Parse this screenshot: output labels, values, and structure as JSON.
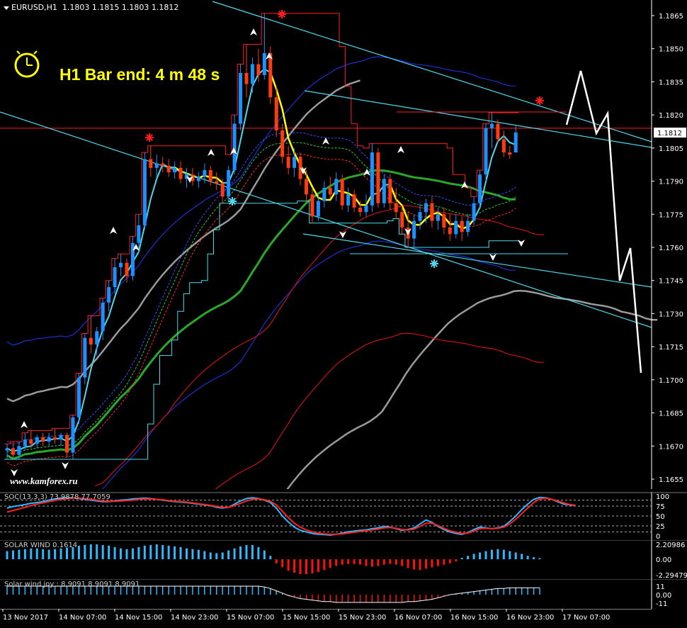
{
  "header": {
    "symbol": "EURUSD,H1",
    "ohlc": "1.1803 1.1815 1.1803 1.1812"
  },
  "bar_end_label": "H1 Bar end: 4 m 48 s",
  "watermark": "www.kamforex.ru",
  "current_price_label": "1.1812",
  "panels": {
    "stochastic_label": "SOC(13,3,3) 73.9878 77.7059",
    "solar_wind_label": "SOLAR WIND 0.1614",
    "solar_wind_joy_label": "Solar wind joy : 8.9091 8.9091 8.9091"
  },
  "colors": {
    "bull": "#1e90ff",
    "bear": "#ff3b10",
    "cyan": "#4fd9ea",
    "red_line": "#ff1c1c",
    "yellow": "#ffff00",
    "grid": "#262626"
  },
  "chart_data": [
    {
      "type": "candlestick",
      "title": "EURUSD,H1",
      "y_axis_ticks": [
        "1.1865",
        "1.1850",
        "1.1835",
        "1.1820",
        "1.1805",
        "1.1790",
        "1.1775",
        "1.1760",
        "1.1745",
        "1.1730",
        "1.1715",
        "1.1700",
        "1.1685",
        "1.1670",
        "1.1655"
      ],
      "x_axis_ticks": [
        "13 Nov 2017",
        "14 Nov 07:00",
        "14 Nov 15:00",
        "14 Nov 23:00",
        "15 Nov 07:00",
        "15 Nov 15:00",
        "15 Nov 23:00",
        "16 Nov 07:00",
        "16 Nov 15:00",
        "16 Nov 23:00",
        "17 Nov 07:00"
      ],
      "ylim": [
        1.165,
        1.187
      ],
      "candles_ohlc": [
        [
          1.1668,
          1.1671,
          1.1664,
          1.1669
        ],
        [
          1.1669,
          1.1672,
          1.1665,
          1.1666
        ],
        [
          1.1666,
          1.1672,
          1.1664,
          1.167
        ],
        [
          1.167,
          1.1676,
          1.1668,
          1.1673
        ],
        [
          1.1673,
          1.1677,
          1.1669,
          1.1671
        ],
        [
          1.1671,
          1.1675,
          1.1669,
          1.1674
        ],
        [
          1.1674,
          1.1676,
          1.167,
          1.1672
        ],
        [
          1.1672,
          1.1676,
          1.167,
          1.1674
        ],
        [
          1.1674,
          1.1678,
          1.1671,
          1.1673
        ],
        [
          1.1673,
          1.1676,
          1.167,
          1.1675
        ],
        [
          1.1675,
          1.1676,
          1.1665,
          1.1667
        ],
        [
          1.1667,
          1.1684,
          1.1664,
          1.1683
        ],
        [
          1.1683,
          1.1703,
          1.168,
          1.1701
        ],
        [
          1.1701,
          1.1721,
          1.1698,
          1.1719
        ],
        [
          1.1719,
          1.1729,
          1.1712,
          1.1716
        ],
        [
          1.1716,
          1.1724,
          1.1711,
          1.1722
        ],
        [
          1.1722,
          1.1737,
          1.1718,
          1.1735
        ],
        [
          1.1735,
          1.1745,
          1.1731,
          1.1742
        ],
        [
          1.1742,
          1.1755,
          1.1739,
          1.1751
        ],
        [
          1.1751,
          1.1757,
          1.1747,
          1.1753
        ],
        [
          1.1753,
          1.1755,
          1.1744,
          1.1747
        ],
        [
          1.1747,
          1.1765,
          1.1745,
          1.1762
        ],
        [
          1.1762,
          1.1775,
          1.1757,
          1.177
        ],
        [
          1.177,
          1.1803,
          1.1768,
          1.18
        ],
        [
          1.18,
          1.1806,
          1.1792,
          1.1796
        ],
        [
          1.1796,
          1.1802,
          1.1792,
          1.1798
        ],
        [
          1.1798,
          1.1801,
          1.1794,
          1.1797
        ],
        [
          1.1797,
          1.18,
          1.1792,
          1.1794
        ],
        [
          1.1794,
          1.1799,
          1.1791,
          1.1796
        ],
        [
          1.1796,
          1.1799,
          1.1789,
          1.1791
        ],
        [
          1.1791,
          1.1796,
          1.1787,
          1.1793
        ],
        [
          1.1793,
          1.1796,
          1.1788,
          1.179
        ],
        [
          1.179,
          1.1794,
          1.1787,
          1.1792
        ],
        [
          1.1792,
          1.1798,
          1.1789,
          1.1795
        ],
        [
          1.1795,
          1.1797,
          1.1788,
          1.179
        ],
        [
          1.179,
          1.1794,
          1.1786,
          1.1789
        ],
        [
          1.1789,
          1.1791,
          1.178,
          1.1783
        ],
        [
          1.1783,
          1.1797,
          1.1781,
          1.1795
        ],
        [
          1.1795,
          1.182,
          1.1793,
          1.1816
        ],
        [
          1.1816,
          1.1843,
          1.1813,
          1.1839
        ],
        [
          1.1839,
          1.1852,
          1.1828,
          1.1834
        ],
        [
          1.1834,
          1.1846,
          1.183,
          1.1843
        ],
        [
          1.1843,
          1.185,
          1.1835,
          1.1838
        ],
        [
          1.1838,
          1.1866,
          1.1836,
          1.1848
        ],
        [
          1.1848,
          1.1851,
          1.1825,
          1.1828
        ],
        [
          1.1828,
          1.1833,
          1.181,
          1.1813
        ],
        [
          1.1813,
          1.1816,
          1.1798,
          1.1801
        ],
        [
          1.1801,
          1.1806,
          1.1793,
          1.1796
        ],
        [
          1.1796,
          1.1805,
          1.1792,
          1.1801
        ],
        [
          1.1801,
          1.1803,
          1.1788,
          1.1791
        ],
        [
          1.1791,
          1.1795,
          1.1781,
          1.1784
        ],
        [
          1.1784,
          1.1787,
          1.1771,
          1.1774
        ],
        [
          1.1774,
          1.1784,
          1.1772,
          1.1781
        ],
        [
          1.1781,
          1.179,
          1.1778,
          1.1787
        ],
        [
          1.1787,
          1.1792,
          1.1782,
          1.1784
        ],
        [
          1.1784,
          1.1794,
          1.1781,
          1.1791
        ],
        [
          1.1791,
          1.1793,
          1.1777,
          1.1779
        ],
        [
          1.1779,
          1.1787,
          1.1776,
          1.1784
        ],
        [
          1.1784,
          1.1786,
          1.1776,
          1.1778
        ],
        [
          1.1778,
          1.1781,
          1.1774,
          1.1776
        ],
        [
          1.1776,
          1.1784,
          1.1774,
          1.1779
        ],
        [
          1.1779,
          1.1807,
          1.1776,
          1.1803
        ],
        [
          1.1803,
          1.1805,
          1.1778,
          1.178
        ],
        [
          1.178,
          1.1793,
          1.1778,
          1.1791
        ],
        [
          1.1791,
          1.1793,
          1.1777,
          1.178
        ],
        [
          1.178,
          1.1787,
          1.1773,
          1.1776
        ],
        [
          1.1776,
          1.1779,
          1.1766,
          1.1769
        ],
        [
          1.1769,
          1.1776,
          1.176,
          1.1764
        ],
        [
          1.1764,
          1.1775,
          1.176,
          1.1772
        ],
        [
          1.1772,
          1.178,
          1.1768,
          1.1776
        ],
        [
          1.1776,
          1.1782,
          1.1771,
          1.178
        ],
        [
          1.178,
          1.1783,
          1.1769,
          1.1772
        ],
        [
          1.1772,
          1.1778,
          1.1768,
          1.1775
        ],
        [
          1.1775,
          1.1778,
          1.1766,
          1.1769
        ],
        [
          1.1769,
          1.1775,
          1.1763,
          1.1766
        ],
        [
          1.1766,
          1.1775,
          1.1764,
          1.1772
        ],
        [
          1.1772,
          1.1774,
          1.1763,
          1.1767
        ],
        [
          1.1767,
          1.1775,
          1.1765,
          1.1772
        ],
        [
          1.1772,
          1.1783,
          1.177,
          1.178
        ],
        [
          1.178,
          1.1795,
          1.1778,
          1.1793
        ],
        [
          1.1793,
          1.1816,
          1.179,
          1.1814
        ],
        [
          1.1814,
          1.1821,
          1.1805,
          1.1816
        ],
        [
          1.1816,
          1.1818,
          1.1807,
          1.1809
        ],
        [
          1.1809,
          1.1813,
          1.1801,
          1.1803
        ],
        [
          1.1803,
          1.1806,
          1.18,
          1.1802
        ],
        [
          1.1803,
          1.1815,
          1.1803,
          1.1812
        ]
      ],
      "current_price": 1.1812,
      "horizontal_line": 1.1814
    },
    {
      "type": "line",
      "title": "SOC(13,3,3) 73.9878 77.7059",
      "y_axis_ticks": [
        "100",
        "75",
        "50",
        "25",
        "0"
      ],
      "levels": [
        90,
        75,
        50,
        25,
        10
      ],
      "series": [
        {
          "values": [
            70,
            74,
            76,
            79,
            82,
            84,
            86,
            90,
            93,
            95,
            96,
            96,
            94,
            92,
            90,
            88,
            86,
            86,
            88,
            90,
            91,
            93,
            94,
            95,
            94,
            92,
            90,
            88,
            86,
            85,
            84,
            82,
            80,
            78,
            76,
            72,
            70,
            72,
            80,
            88,
            94,
            96,
            94,
            90,
            84,
            70,
            50,
            35,
            22,
            14,
            10,
            6,
            4,
            3,
            2,
            4,
            7,
            10,
            12,
            14,
            15,
            18,
            20,
            24,
            22,
            18,
            14,
            16,
            20,
            30,
            40,
            34,
            24,
            16,
            10,
            6,
            4,
            8,
            16,
            22,
            20,
            18,
            20,
            24,
            36,
            50,
            66,
            80,
            92,
            97,
            96,
            92,
            86,
            80,
            78,
            76
          ]
        },
        {
          "values": [
            60,
            64,
            68,
            72,
            76,
            80,
            83,
            86,
            89,
            92,
            94,
            95,
            95,
            94,
            92,
            90,
            88,
            87,
            87,
            88,
            89,
            90,
            92,
            93,
            93,
            92,
            91,
            89,
            87,
            86,
            85,
            83,
            81,
            79,
            77,
            74,
            72,
            72,
            76,
            82,
            88,
            92,
            93,
            91,
            87,
            78,
            62,
            46,
            32,
            22,
            15,
            10,
            7,
            5,
            4,
            4,
            5,
            7,
            9,
            11,
            13,
            15,
            17,
            20,
            21,
            19,
            16,
            15,
            17,
            24,
            32,
            32,
            26,
            19,
            13,
            9,
            6,
            7,
            12,
            18,
            19,
            18,
            19,
            22,
            30,
            42,
            56,
            70,
            84,
            93,
            95,
            92,
            88,
            83,
            79,
            77
          ]
        }
      ]
    },
    {
      "type": "bar",
      "title": "SOLAR WIND 0.1614",
      "y_axis_ticks": [
        "2.20986",
        "0.00",
        "-2.29479"
      ],
      "ylim": [
        -2.29479,
        2.20986
      ],
      "values": [
        1.2,
        1.3,
        1.4,
        1.5,
        1.6,
        1.6,
        1.5,
        1.4,
        1.5,
        1.6,
        1.7,
        1.8,
        2.0,
        2.1,
        2.2,
        2.2,
        2.1,
        2.0,
        1.8,
        1.6,
        1.5,
        1.6,
        1.8,
        2.0,
        2.1,
        2.2,
        2.1,
        2.0,
        1.9,
        1.8,
        1.6,
        1.5,
        1.4,
        1.2,
        1.0,
        0.9,
        1.0,
        1.3,
        1.6,
        1.9,
        2.1,
        2.1,
        1.8,
        1.3,
        0.5,
        -0.6,
        -1.2,
        -1.7,
        -2.0,
        -2.2,
        -2.2,
        -2.1,
        -1.9,
        -1.6,
        -1.3,
        -1.0,
        -0.8,
        -0.7,
        -0.7,
        -0.8,
        -1.0,
        -1.1,
        -1.0,
        -0.8,
        -0.7,
        -0.8,
        -1.0,
        -1.3,
        -1.5,
        -1.6,
        -1.4,
        -1.2,
        -1.0,
        -0.8,
        -0.6,
        -0.3,
        0.2,
        0.5,
        0.8,
        1.0,
        1.2,
        1.4,
        1.5,
        1.4,
        1.2,
        1.0,
        0.8,
        0.5,
        0.3,
        0.16
      ]
    },
    {
      "type": "bar",
      "title": "Solar wind joy : 8.9091 8.9091 8.9091",
      "y_axis_ticks": [
        "11",
        "0.00",
        "-11"
      ],
      "ylim": [
        -11,
        11
      ],
      "values": [
        11,
        11,
        11,
        11,
        11,
        11,
        11,
        11,
        11,
        11,
        11,
        11,
        11,
        11,
        11,
        11,
        11,
        11,
        11,
        11,
        11,
        11,
        11,
        11,
        11,
        11,
        11,
        11,
        11,
        11,
        11,
        11,
        11,
        11,
        11,
        11,
        11,
        11,
        11,
        11,
        11,
        11,
        11,
        10,
        8,
        5,
        2,
        -1,
        -3,
        -5,
        -6,
        -7,
        -8,
        -9,
        -9,
        -10,
        -10,
        -10,
        -10,
        -10,
        -10,
        -10,
        -10,
        -10,
        -10,
        -10,
        -10,
        -9,
        -9,
        -8,
        -7,
        -6,
        -4,
        -2,
        0,
        1,
        2,
        3,
        4,
        5,
        6,
        7,
        8,
        8,
        9,
        9,
        9,
        9,
        9,
        8.9
      ]
    }
  ]
}
